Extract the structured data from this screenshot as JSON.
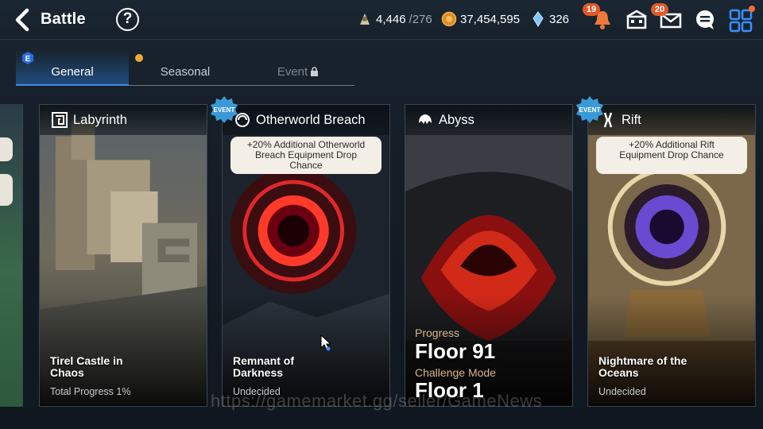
{
  "header": {
    "title": "Battle",
    "help_label": "?",
    "stamina": {
      "value": "4,446",
      "max": "/276",
      "icon": "stamina-icon"
    },
    "gold": {
      "value": "37,454,595",
      "icon": "gold-icon"
    },
    "crystal": {
      "value": "326",
      "icon": "crystal-icon"
    },
    "notifications_badge": "19",
    "mail_badge": "20"
  },
  "tabs": [
    {
      "label": "General",
      "active": true,
      "badge": "E"
    },
    {
      "label": "Seasonal",
      "active": false
    },
    {
      "label": "Event",
      "active": false,
      "locked": true
    }
  ],
  "cards": [
    {
      "title": "Labyrinth",
      "name": "Tirel Castle in Chaos",
      "status": "Total Progress 1%",
      "event": false
    },
    {
      "title": "Otherworld Breach",
      "name": "Remnant of Darkness",
      "status": "Undecided",
      "event": true,
      "notice": "+20% Additional Otherworld Breach Equipment Drop Chance"
    },
    {
      "title": "Abyss",
      "progress_label": "Progress",
      "progress_value": "Floor 91",
      "challenge_label": "Challenge Mode",
      "challenge_value": "Floor 1",
      "event": false
    },
    {
      "title": "Rift",
      "name": "Nightmare of the Oceans",
      "status": "Undecided",
      "event": true,
      "notice": "+20% Additional Rift Equipment Drop Chance"
    }
  ],
  "event_badge": "EVENT",
  "watermark": "https://gamemarket.gg/seller/GameNews",
  "colors": {
    "accent": "#3c8ee0",
    "badge": "#e0582a",
    "notice_bg": "#f4efe6"
  }
}
